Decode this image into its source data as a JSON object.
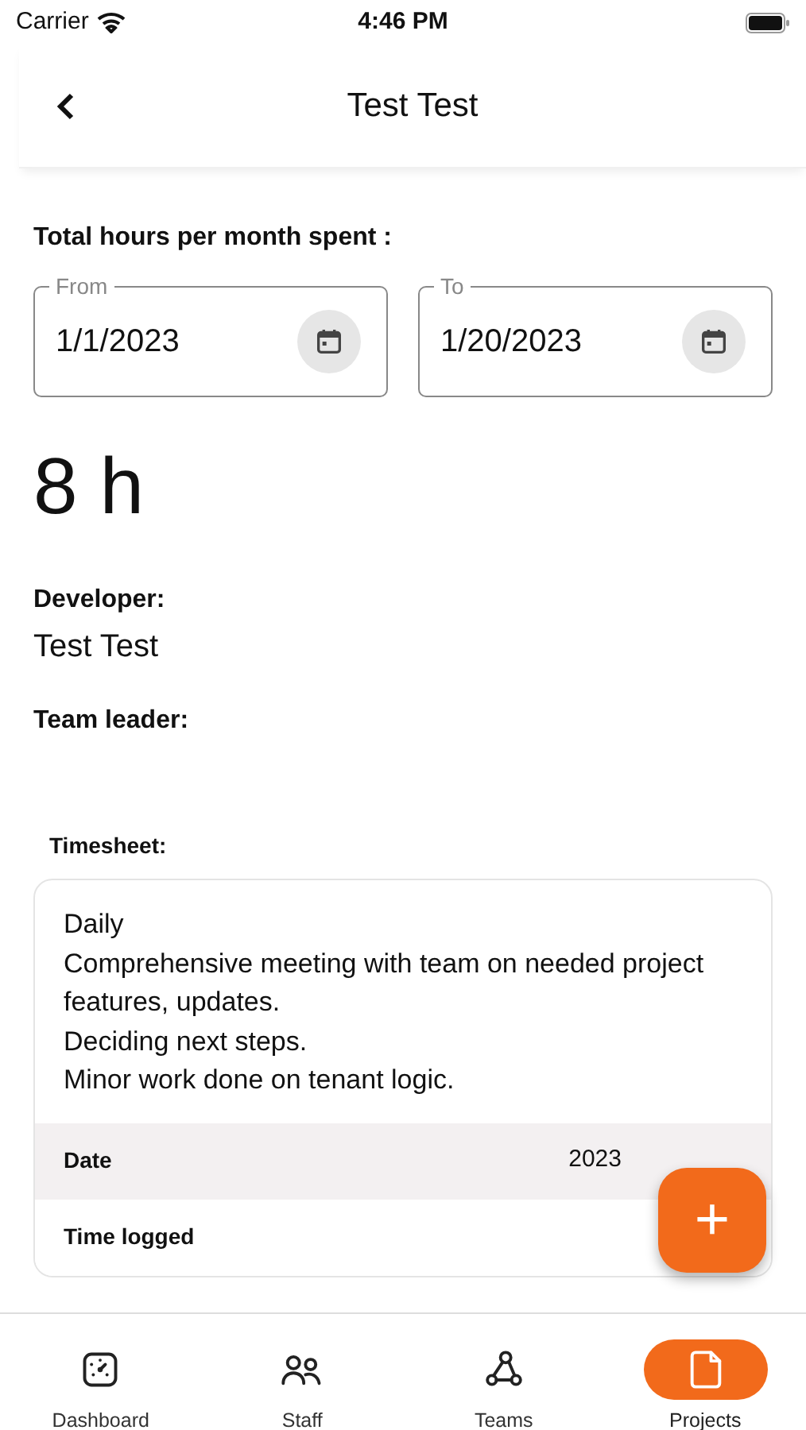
{
  "status_bar": {
    "carrier": "Carrier",
    "time": "4:46 PM"
  },
  "header": {
    "title": "Test Test"
  },
  "hours": {
    "label": "Total hours per month spent :",
    "from": {
      "label": "From",
      "value": "1/1/2023"
    },
    "to": {
      "label": "To",
      "value": "1/20/2023"
    },
    "total": "8 h"
  },
  "developer": {
    "label": "Developer:",
    "value": "Test Test"
  },
  "team_leader": {
    "label": "Team leader:"
  },
  "timesheet": {
    "label": "Timesheet:",
    "description": "Daily\nComprehensive meeting with team on needed project features, updates.\nDeciding next steps.\nMinor work done on tenant logic.",
    "rows": [
      {
        "label": "Date",
        "value": "2023",
        "shaded": true
      },
      {
        "label": "Time logged",
        "shaded": false
      }
    ]
  },
  "fab": {
    "label": "+"
  },
  "nav": [
    {
      "kind": "dashboard",
      "label": "Dashboard",
      "selected": false
    },
    {
      "kind": "staff",
      "label": "Staff",
      "selected": false
    },
    {
      "kind": "teams",
      "label": "Teams",
      "selected": false
    },
    {
      "kind": "projects",
      "label": "Projects",
      "selected": true
    }
  ]
}
